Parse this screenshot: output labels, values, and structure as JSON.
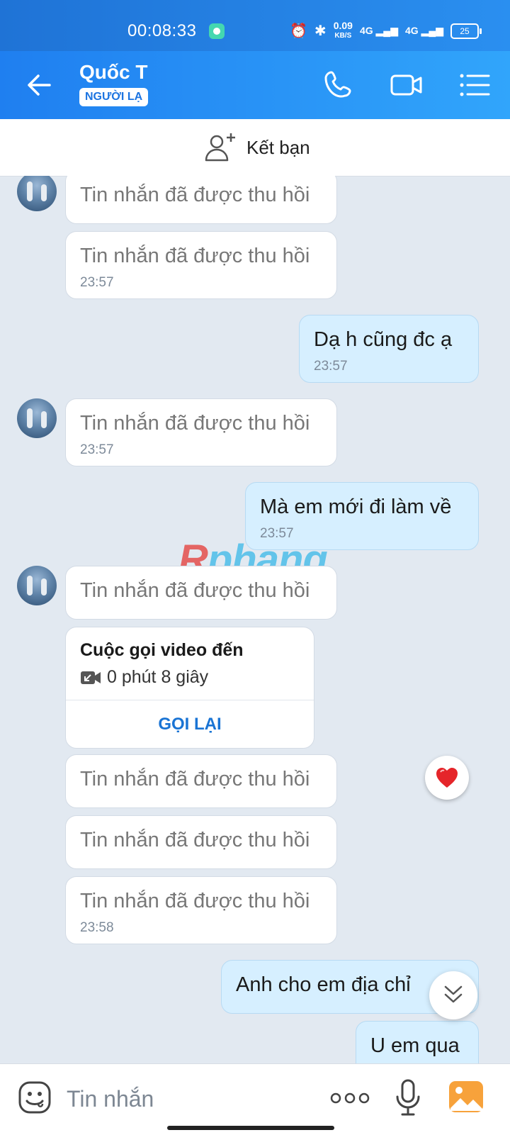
{
  "status_bar": {
    "time": "00:08:33",
    "speed_value": "0.09",
    "speed_unit": "KB/S",
    "signal1": "4G",
    "signal2": "4G",
    "battery": "25"
  },
  "header": {
    "name": "Quốc T",
    "badge": "NGƯỜI LẠ"
  },
  "add_friend": {
    "label": "Kết bạn"
  },
  "messages": [
    {
      "text": "Tin nhắn đã được thu hồi",
      "time": ""
    },
    {
      "text": "Tin nhắn đã được thu hồi",
      "time": "23:57"
    },
    {
      "text": "Dạ h cũng đc ạ",
      "time": "23:57"
    },
    {
      "text": "Tin nhắn đã được thu hồi",
      "time": "23:57"
    },
    {
      "text": "Mà em mới đi làm về",
      "time": "23:57"
    },
    {
      "text": "Tin nhắn đã được thu hồi",
      "time": ""
    },
    {
      "text": "Tin nhắn đã được thu hồi",
      "time": ""
    },
    {
      "text": "Tin nhắn đã được thu hồi",
      "time": ""
    },
    {
      "text": "Tin nhắn đã được thu hồi",
      "time": "23:58"
    },
    {
      "text": "Anh cho em địa chỉ",
      "time": ""
    },
    {
      "text": "U em qua",
      "time": ""
    }
  ],
  "call_card": {
    "title": "Cuộc gọi video đến",
    "duration": "0 phút 8 giây",
    "action": "GỌI LẠI"
  },
  "watermark": {
    "first": "R",
    "rest": "phang"
  },
  "input": {
    "placeholder": "Tin nhắn"
  },
  "colors": {
    "header": "#1f7ff0",
    "outgoing_bubble": "#d6efff",
    "incoming_bubble": "#ffffff",
    "chat_bg": "#e2e9f1",
    "accent": "#1a74d4"
  }
}
